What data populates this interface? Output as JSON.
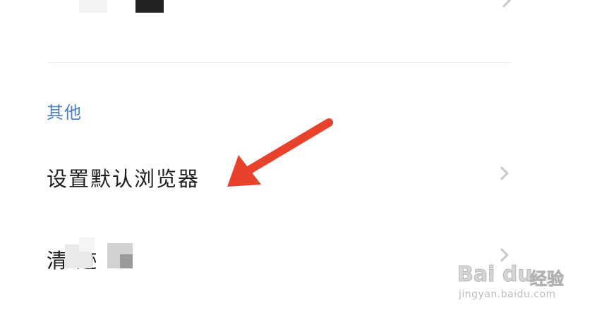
{
  "section": {
    "title": "其他"
  },
  "settings": {
    "items": [
      {
        "label": "设置默认浏览器"
      },
      {
        "label": "清  迹"
      }
    ]
  },
  "watermark": {
    "logo": "Bai du",
    "text": "经验",
    "url": "jingyan.baidu.com"
  },
  "colors": {
    "accent": "#4a7fc1",
    "arrow": "#e8412c",
    "chevron": "#c9c9c9",
    "divider": "#ececec"
  }
}
